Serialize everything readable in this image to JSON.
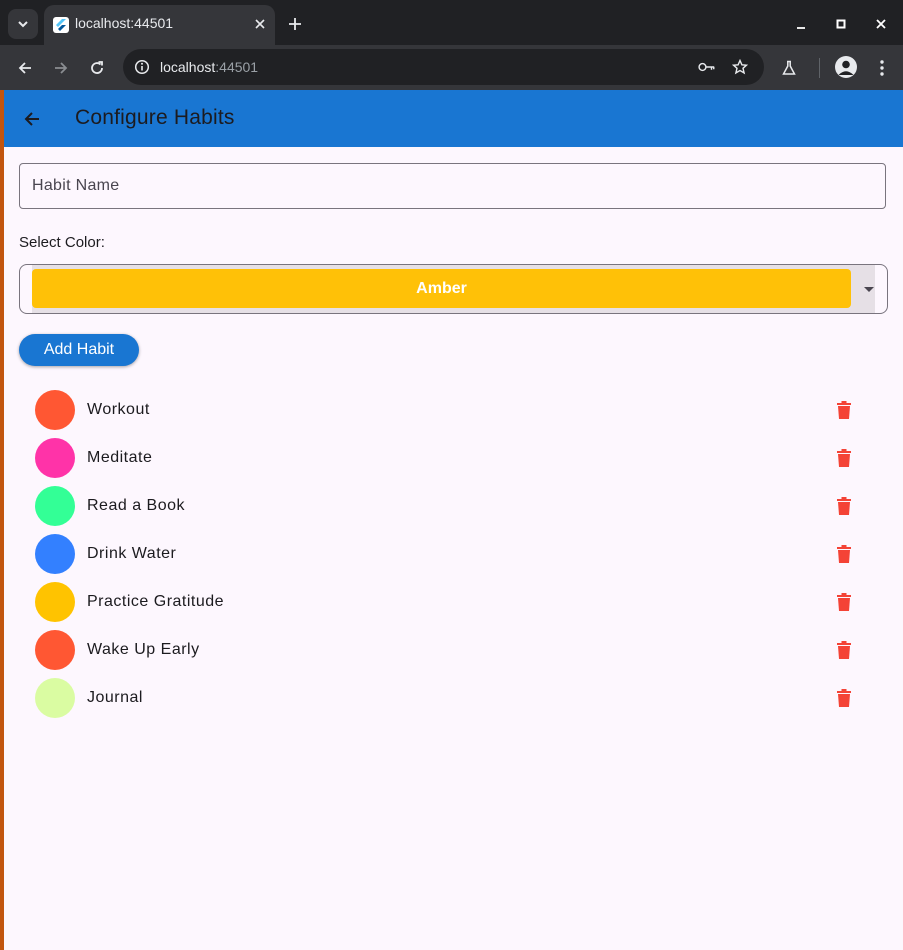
{
  "browser": {
    "tab_title": "localhost:44501",
    "url_host": "localhost",
    "url_port": ":44501"
  },
  "app": {
    "title": "Configure Habits",
    "appbar_color": "#1976d2",
    "habit_name_placeholder": "Habit Name",
    "habit_name_value": "",
    "select_color_label": "Select Color:",
    "selected_color": {
      "name": "Amber",
      "hex": "#ffc107"
    },
    "add_button_label": "Add Habit",
    "delete_color": "#f44336"
  },
  "habits": [
    {
      "name": "Workout",
      "color": "#ff5733"
    },
    {
      "name": "Meditate",
      "color": "#ff33a8"
    },
    {
      "name": "Read a Book",
      "color": "#33ff96"
    },
    {
      "name": "Drink Water",
      "color": "#3380ff"
    },
    {
      "name": "Practice Gratitude",
      "color": "#ffc300"
    },
    {
      "name": "Wake Up Early",
      "color": "#ff5733"
    },
    {
      "name": "Journal",
      "color": "#dafca2"
    }
  ]
}
